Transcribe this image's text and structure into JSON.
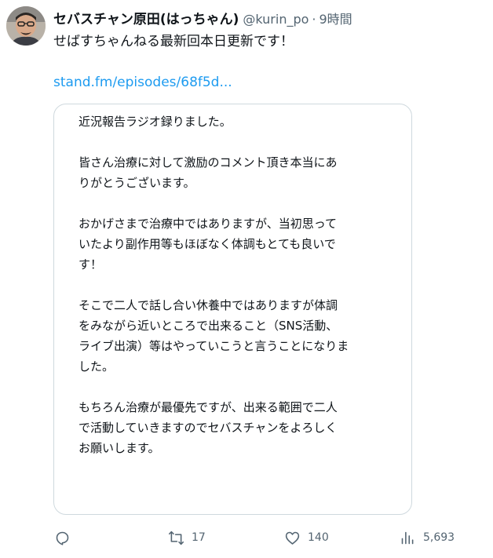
{
  "author": {
    "display_name": "セバスチャン原田(はっちゃん)",
    "handle": "@kurin_po",
    "separator": "·",
    "time": "9時間"
  },
  "tweet": {
    "text": "せばすちゃんねる最新回本日更新です！",
    "link": "stand.fm/episodes/68f5d..."
  },
  "card": {
    "paragraphs": [
      [
        "近況報告ラジオ録りました。"
      ],
      [
        "皆さん治療に対して激励のコメント頂き本当にあ",
        "りがとうございます。"
      ],
      [
        "おかげさまで治療中ではありますが、当初思って",
        "いたより副作用等もほぼなく体調もとても良いで",
        "す！"
      ],
      [
        "そこで二人で話し合い休養中ではありますが体調",
        "をみながら近いところで出来ること（SNS活動、",
        "ライブ出演）等はやっていこうと言うことになりま",
        "した。"
      ],
      [
        "もちろん治療が最優先ですが、出来る範囲で二人",
        "で活動していきますのでセバスチャンをよろしく",
        "お願いします。"
      ]
    ]
  },
  "actions": {
    "reply": {
      "icon": "reply-icon",
      "count": ""
    },
    "retweet": {
      "icon": "retweet-icon",
      "count": "17"
    },
    "like": {
      "icon": "heart-icon",
      "count": "140"
    },
    "views": {
      "icon": "analytics-icon",
      "count": "5,693"
    }
  },
  "colors": {
    "link": "#1d9bf0",
    "secondary_text": "#536471",
    "border": "#cfd9de"
  }
}
